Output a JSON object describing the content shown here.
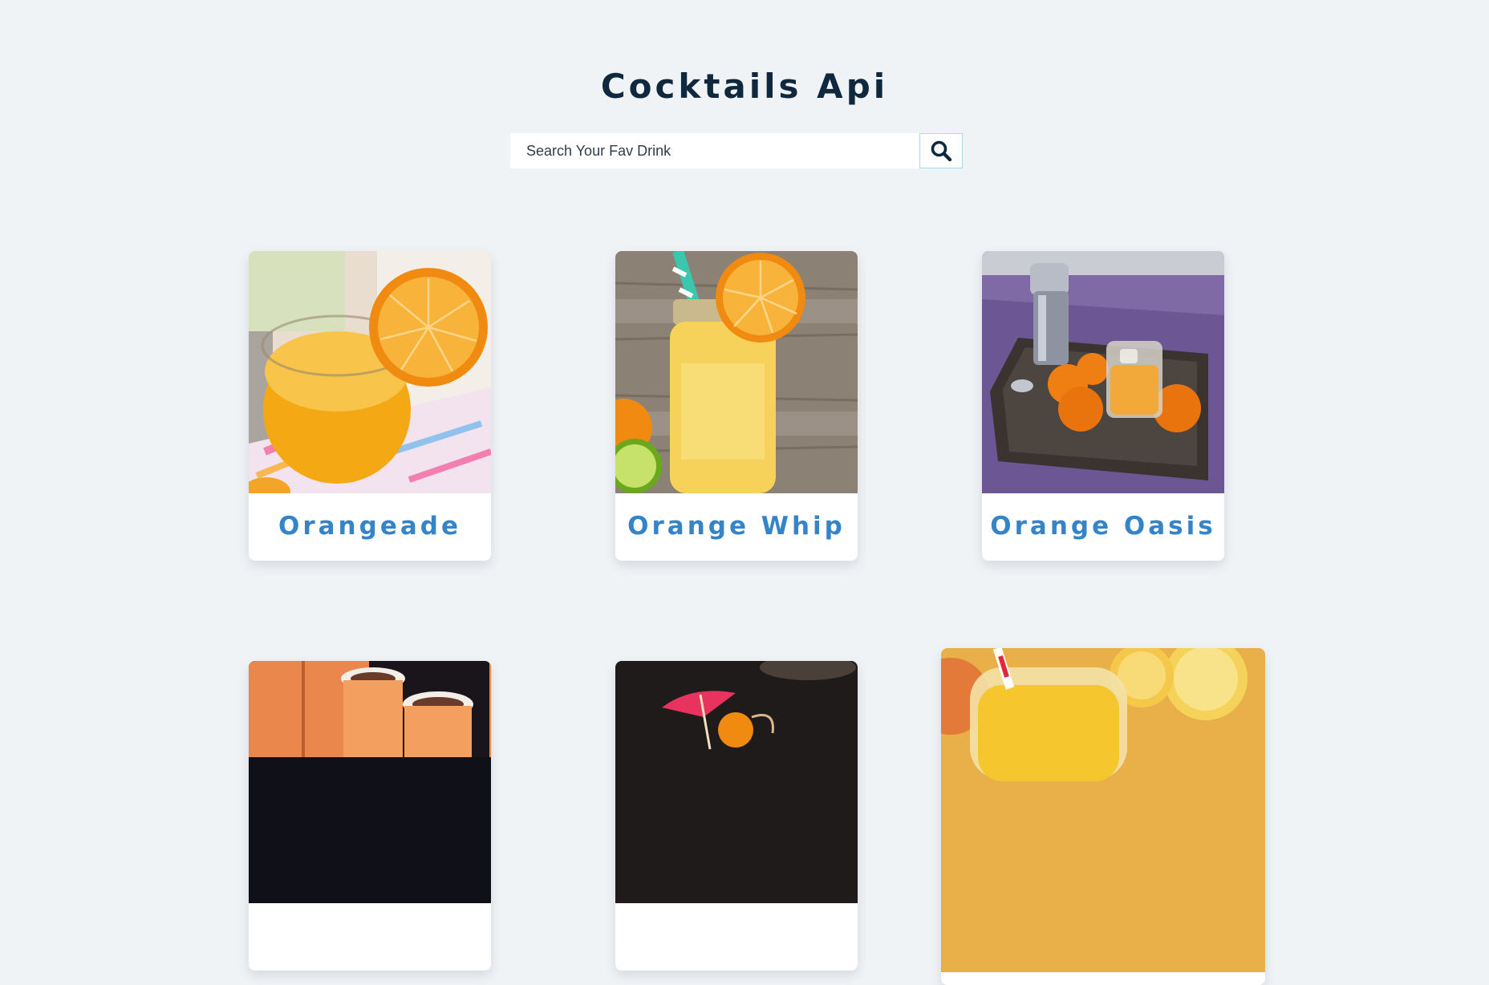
{
  "header": {
    "title": "Cocktails Api"
  },
  "search": {
    "placeholder": "Search Your Fav Drink",
    "value": "",
    "button_icon": "search-icon"
  },
  "drinks": [
    {
      "name": "Orangeade",
      "image": "orangeade-photo"
    },
    {
      "name": "Orange Whip",
      "image": "orange-whip-photo"
    },
    {
      "name": "Orange Oasis",
      "image": "orange-oasis-photo"
    },
    {
      "name": "",
      "image": "orange-shots-photo"
    },
    {
      "name": "",
      "image": "tropical-drink-photo"
    },
    {
      "name": "",
      "image": "lemon-drink-photo"
    }
  ],
  "colors": {
    "background": "#f0f3f6",
    "title": "#10283d",
    "card_title": "#3584c8",
    "search_border": "#a9d7ec"
  }
}
